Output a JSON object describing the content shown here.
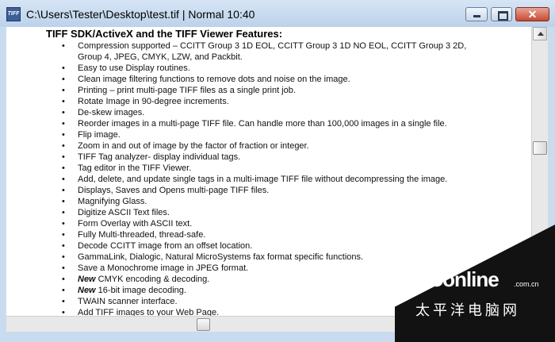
{
  "window": {
    "title": "C:\\Users\\Tester\\Desktop\\test.tif | Normal 10:40",
    "app_icon_text": "TIFF",
    "close_glyph": "✕"
  },
  "document": {
    "heading": "TIFF SDK/ActiveX and the TIFF Viewer Features:",
    "bullet_char": "•",
    "items": [
      {
        "prefix": "",
        "text": "Compression supported – CCITT Group 3 1D EOL, CCITT Group 3 1D NO EOL, CCITT Group 3 2D,"
      },
      {
        "prefix": "",
        "text": "Group 4, JPEG,  CMYK, LZW, and Packbit.",
        "continuation": true
      },
      {
        "prefix": "",
        "text": "Easy to use Display routines."
      },
      {
        "prefix": "",
        "text": "Clean image filtering functions to remove dots and noise on the image."
      },
      {
        "prefix": "",
        "text": "Printing – print multi-page TIFF files as a single print job."
      },
      {
        "prefix": "",
        "text": "Rotate Image in 90-degree increments."
      },
      {
        "prefix": "",
        "text": "De-skew images."
      },
      {
        "prefix": "",
        "text": "Reorder images in a multi-page TIFF file. Can handle more than 100,000 images in a single file."
      },
      {
        "prefix": "",
        "text": "Flip image."
      },
      {
        "prefix": "",
        "text": "Zoom in and out of image by the factor of fraction or integer."
      },
      {
        "prefix": "",
        "text": "TIFF Tag analyzer- display individual tags."
      },
      {
        "prefix": "",
        "text": "Tag editor in the TIFF Viewer."
      },
      {
        "prefix": "",
        "text": "Add, delete, and update single tags in a multi-image TIFF file without decompressing the image."
      },
      {
        "prefix": "",
        "text": "Displays, Saves and Opens multi-page TIFF files."
      },
      {
        "prefix": "",
        "text": "Magnifying Glass."
      },
      {
        "prefix": "",
        "text": "Digitize ASCII Text files."
      },
      {
        "prefix": "",
        "text": "Form Overlay with ASCII text."
      },
      {
        "prefix": "",
        "text": "Fully Multi-threaded, thread-safe."
      },
      {
        "prefix": "",
        "text": "Decode CCITT image from an offset location."
      },
      {
        "prefix": "",
        "text": "GammaLink, Dialogic, Natural MicroSystems fax format specific functions."
      },
      {
        "prefix": "",
        "text": "Save a Monochrome image in JPEG format."
      },
      {
        "prefix": "New",
        "text": " CMYK encoding & decoding."
      },
      {
        "prefix": "New",
        "text": " 16-bit image decoding."
      },
      {
        "prefix": "",
        "text": "TWAIN scanner interface."
      },
      {
        "prefix": "",
        "text": "Add TIFF images to your Web Page."
      }
    ]
  },
  "watermark": {
    "brand": "PConline",
    "domain": ".com.cn",
    "subtitle": "太平洋电脑网"
  }
}
